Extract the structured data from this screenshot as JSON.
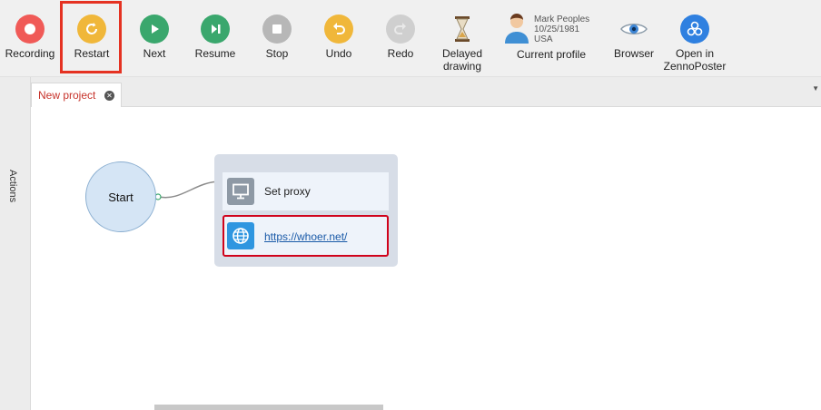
{
  "toolbar": {
    "recording": "Recording",
    "restart": "Restart",
    "next": "Next",
    "resume": "Resume",
    "stop": "Stop",
    "undo": "Undo",
    "redo": "Redo",
    "delayed_line1": "Delayed",
    "delayed_line2": "drawing",
    "profile_name": "Mark Peoples",
    "profile_dob": "10/25/1981",
    "profile_country": "USA",
    "current_profile": "Current profile",
    "browser": "Browser",
    "open_line1": "Open in",
    "open_line2": "ZennoPoster"
  },
  "sidebar": {
    "actions_label": "Actions"
  },
  "tabs": [
    {
      "label": "New project"
    }
  ],
  "canvas": {
    "start_label": "Start",
    "actions": [
      {
        "label": "Set proxy",
        "icon": "monitor-icon"
      },
      {
        "label": "https://whoer.net/",
        "icon": "globe-icon"
      }
    ]
  },
  "colors": {
    "recording": "#f05a57",
    "restart": "#f0b73a",
    "next": "#3aa76d",
    "resume": "#3aa76d",
    "stop": "#b7b7b7",
    "undo": "#f0b73a",
    "redo": "#cfcfcf",
    "open_zenno": "#2f80e0",
    "highlight": "#e53222"
  }
}
